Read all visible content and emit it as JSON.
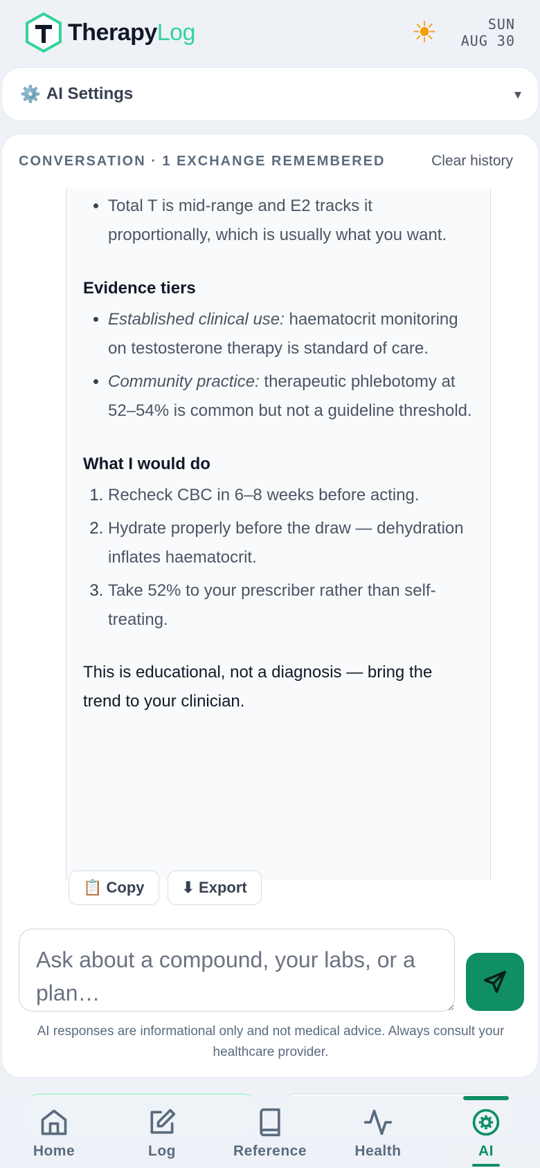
{
  "header": {
    "brand_part1": "Therapy",
    "brand_part2": "Log",
    "logo_letter": "T",
    "weather_icon": "sun-icon",
    "day": "SUN",
    "date": "AUG 30"
  },
  "settings": {
    "icon": "gear-icon",
    "title": "AI Settings",
    "chevron": "▾"
  },
  "conversation": {
    "label": "CONVERSATION · 1 EXCHANGE REMEMBERED",
    "clear_label": "Clear history",
    "message": {
      "top_bullets": [
        "Total T is mid-range and E2 tracks it proportionally, which is usually what you want."
      ],
      "evidence_heading": "Evidence tiers",
      "evidence_items": [
        {
          "label": "Established clinical use:",
          "text": " haematocrit monitoring on testosterone therapy is standard of care."
        },
        {
          "label": "Community practice:",
          "text": " therapeutic phlebotomy at 52–54% is common but not a guideline threshold."
        }
      ],
      "plan_heading": "What I would do",
      "plan_items": [
        "Recheck CBC in 6–8 weeks before acting.",
        "Hydrate properly before the draw — dehydration inflates haematocrit.",
        "Take 52% to your prescriber rather than self-treating."
      ],
      "closing": "This is educational, not a diagnosis — bring the trend to your clinician."
    },
    "copy_label": "📋 Copy",
    "export_label": "⬇ Export"
  },
  "composer": {
    "placeholder": "Ask about a compound, your labs, or a plan…",
    "value": "",
    "send_icon": "send-icon"
  },
  "disclaimer": "AI responses are informational only and not medical advice. Always consult your healthcare provider.",
  "nav": {
    "items": [
      {
        "label": "Home",
        "icon": "home-icon"
      },
      {
        "label": "Log",
        "icon": "edit-icon"
      },
      {
        "label": "Reference",
        "icon": "book-icon"
      },
      {
        "label": "Health",
        "icon": "activity-icon"
      },
      {
        "label": "AI",
        "icon": "ai-icon"
      }
    ],
    "active": "AI",
    "accent": "#0f8f63"
  },
  "colors": {
    "brand_green": "#34d399",
    "primary": "#0f8f63",
    "background": "#eef2f7"
  }
}
